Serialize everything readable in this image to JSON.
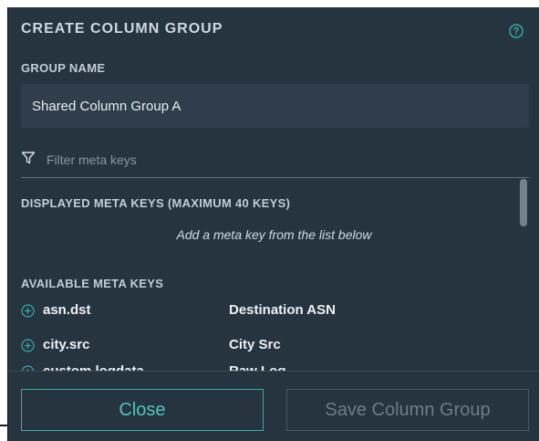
{
  "dialog": {
    "title": "CREATE COLUMN GROUP",
    "help_icon": "question-circle-icon"
  },
  "group_name": {
    "label": "GROUP NAME",
    "value": "Shared Column Group A"
  },
  "filter": {
    "icon": "filter-funnel-icon",
    "placeholder": "Filter meta keys",
    "value": ""
  },
  "displayed_meta_keys": {
    "label": "DISPLAYED META KEYS (MAXIMUM 40 KEYS)",
    "hint": "Add a meta key from the list below"
  },
  "available_meta_keys": {
    "label": "AVAILABLE META KEYS",
    "items": [
      {
        "key": "asn.dst",
        "description": "Destination ASN",
        "icon": "add-circle-icon"
      },
      {
        "key": "city.src",
        "description": "City Src",
        "icon": "add-circle-icon"
      },
      {
        "key": "custom.logdata",
        "description": "Raw Log",
        "icon": "add-circle-icon"
      }
    ]
  },
  "buttons": {
    "close": "Close",
    "save": "Save Column Group"
  },
  "colors": {
    "panel_bg": "#263440",
    "input_bg": "#2f3e4a",
    "accent": "#2fb0a6",
    "disabled": "#6f7b85"
  }
}
